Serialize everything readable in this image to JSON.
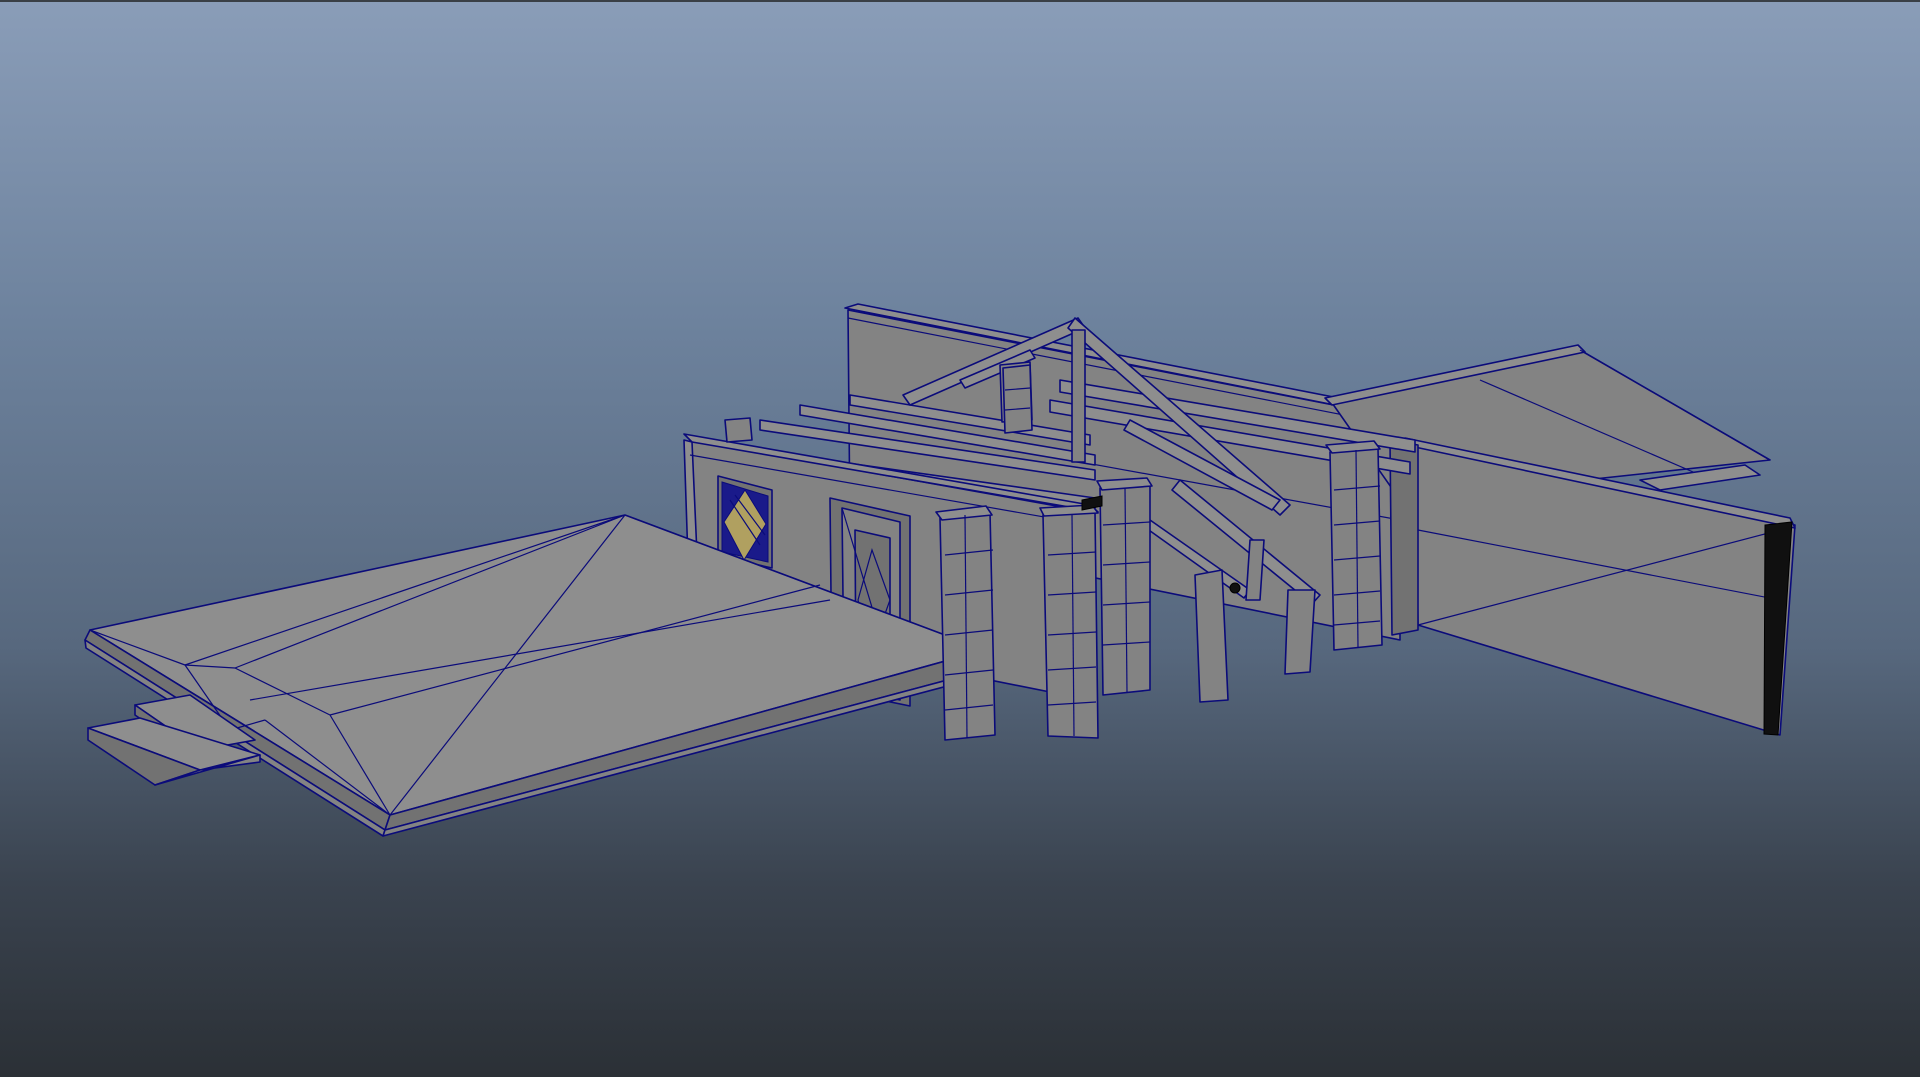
{
  "app": {
    "panel": "perspective-viewport",
    "shading": "smooth-shade-wireframe-on-shaded",
    "colors": {
      "background_top": "#8a9db8",
      "background_bottom": "#2b3036",
      "mesh_fill": "#838383",
      "wireframe": "#0b0b7a"
    }
  },
  "scene": {
    "objects": [
      {
        "name": "stone-platform"
      },
      {
        "name": "front-wall"
      },
      {
        "name": "wooden-pillars"
      },
      {
        "name": "roof-truss"
      },
      {
        "name": "side-wall"
      },
      {
        "name": "back-wall"
      }
    ]
  }
}
